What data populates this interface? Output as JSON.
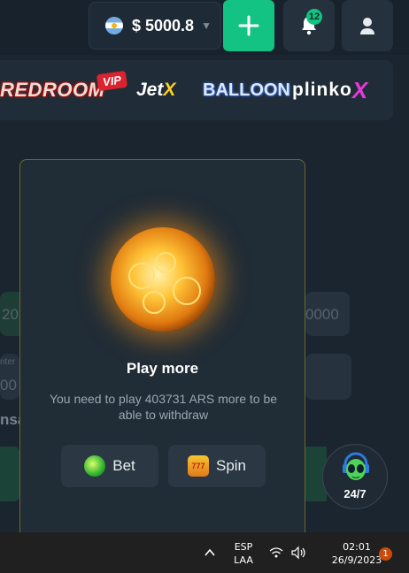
{
  "header": {
    "balance": "$ 5000.8",
    "notification_count": "12",
    "icons": {
      "flag": "argentina-flag-icon",
      "caret": "chevron-down-icon",
      "deposit": "plus-icon",
      "notifications": "bell-icon",
      "profile": "user-icon"
    }
  },
  "games": [
    {
      "name": "REDROOM",
      "badge": "VIP"
    },
    {
      "name": "Jet",
      "accent": "X"
    },
    {
      "name": "BALLOON"
    },
    {
      "name": "plinko",
      "accent": "X"
    }
  ],
  "background": {
    "field_left_value": "20",
    "field_right_value": "0000",
    "field_small_label": "nter",
    "field_left_value2": "00",
    "section_label": "nsa"
  },
  "modal": {
    "title": "Play more",
    "description": "You need to play 403731 ARS more to be able to withdraw",
    "buttons": {
      "bet": "Bet",
      "spin": "Spin"
    },
    "icons": {
      "hero": "coins-fire-icon",
      "bet": "ball-icon",
      "spin": "slot-777-icon"
    }
  },
  "support": {
    "label": "24/7",
    "icon": "alien-support-icon"
  },
  "taskbar": {
    "lang_top": "ESP",
    "lang_bottom": "LAA",
    "time": "02:01",
    "date": "26/9/2023",
    "notification_count": "1"
  },
  "colors": {
    "accent": "#12c383",
    "background": "#1b2530",
    "modal": "#202c36",
    "modal_border": "#6b6a2c"
  }
}
